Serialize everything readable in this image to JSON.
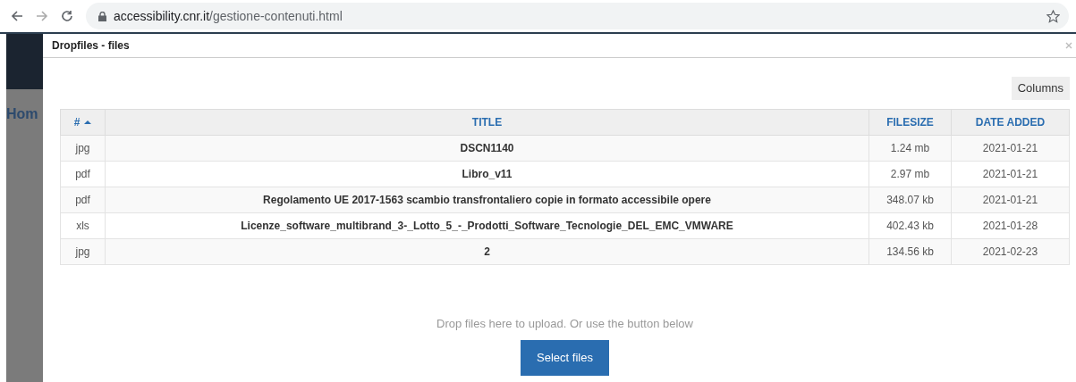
{
  "browser": {
    "url_host": "accessibility.cnr.it",
    "url_path": "/gestione-contenuti.html"
  },
  "background_page": {
    "nav_text": "Hom"
  },
  "modal": {
    "title": "Dropfiles - files",
    "columns_button": "Columns",
    "table": {
      "columns": [
        {
          "label": "#",
          "sorted_ascending": true
        },
        {
          "label": "TITLE",
          "sorted_ascending": false
        },
        {
          "label": "FILESIZE",
          "sorted_ascending": false
        },
        {
          "label": "DATE ADDED",
          "sorted_ascending": false
        }
      ],
      "rows": [
        [
          "jpg",
          "DSCN1140",
          "1.24 mb",
          "2021-01-21"
        ],
        [
          "pdf",
          "Libro_v11",
          "2.97 mb",
          "2021-01-21"
        ],
        [
          "pdf",
          "Regolamento UE 2017-1563 scambio transfrontaliero copie in formato accessibile opere",
          "348.07 kb",
          "2021-01-21"
        ],
        [
          "xls",
          "Licenze_software_multibrand_3-_Lotto_5_-_Prodotti_Software_Tecnologie_DEL_EMC_VMWARE",
          "402.43 kb",
          "2021-01-28"
        ],
        [
          "jpg",
          "2",
          "134.56 kb",
          "2021-02-23"
        ]
      ]
    },
    "drop_hint": "Drop files here to upload. Or use the button below",
    "select_button": "Select files"
  }
}
